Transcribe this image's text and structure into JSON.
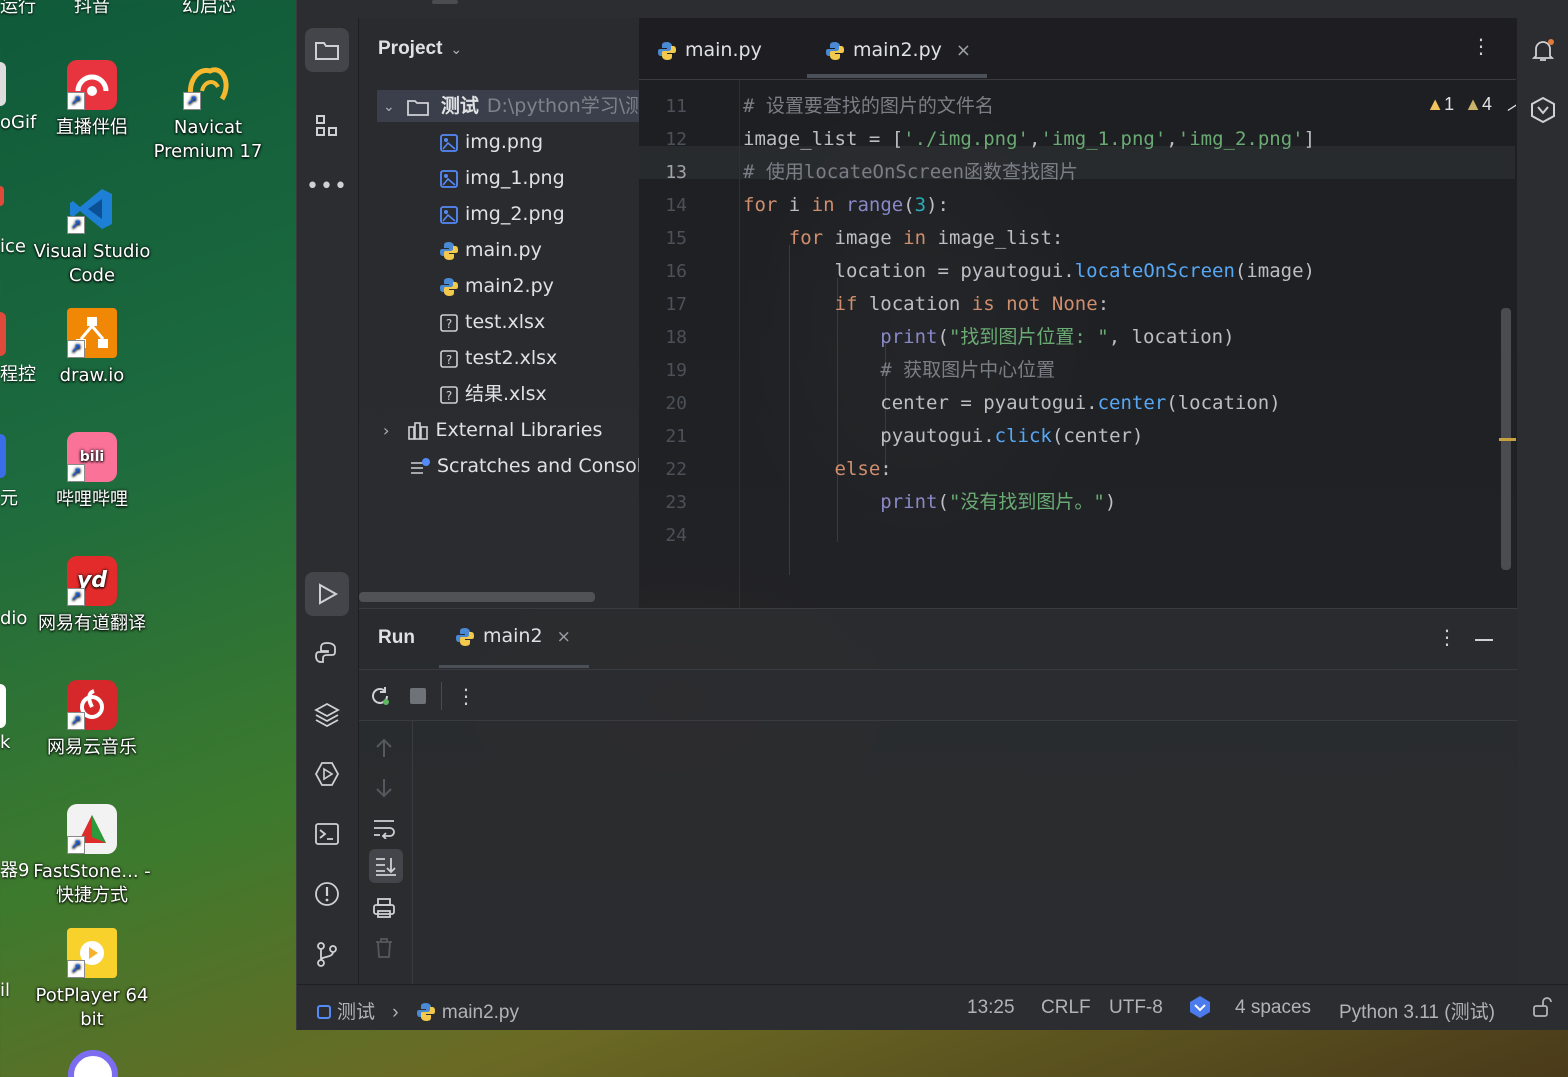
{
  "desktop": {
    "top_labels": [
      "运行",
      "抖音",
      "幻启芯"
    ],
    "icons": [
      {
        "label": "直播伴侣",
        "color": "#e8343f"
      },
      {
        "label": "Navicat Premium 17",
        "color": "#f5b82e"
      },
      {
        "label": "Visual Studio Code",
        "color": "#1e7fd6"
      },
      {
        "label": "draw.io",
        "color": "#f08705"
      },
      {
        "label": "哔哩哔哩",
        "color": "#fb7299"
      },
      {
        "label": "网易有道翻译",
        "color": "#e42b2b"
      },
      {
        "label": "网易云音乐",
        "color": "#d6272b"
      },
      {
        "label": "FastStone... - 快捷方式",
        "color": "#f2f2f2"
      },
      {
        "label": "PotPlayer 64 bit",
        "color": "#f8d12c"
      }
    ],
    "cut_labels": [
      "oGif",
      "ice",
      "程控",
      "元",
      "dio",
      "k",
      "器9",
      "il"
    ]
  },
  "project": {
    "title": "Project",
    "root": {
      "name": "测试",
      "path": "D:\\python学习\\测"
    },
    "files": [
      {
        "name": "img.png",
        "type": "image"
      },
      {
        "name": "img_1.png",
        "type": "image"
      },
      {
        "name": "img_2.png",
        "type": "image"
      },
      {
        "name": "main.py",
        "type": "python"
      },
      {
        "name": "main2.py",
        "type": "python"
      },
      {
        "name": "test.xlsx",
        "type": "unknown"
      },
      {
        "name": "test2.xlsx",
        "type": "unknown"
      },
      {
        "name": "结果.xlsx",
        "type": "unknown"
      }
    ],
    "external": "External Libraries",
    "scratches": "Scratches and Consol"
  },
  "editor": {
    "tabs": [
      {
        "label": "main.py",
        "active": false
      },
      {
        "label": "main2.py",
        "active": true
      }
    ],
    "close_glyph": "×",
    "inspections": {
      "warnings_a": "1",
      "warnings_b": "4"
    },
    "current_line": 13,
    "lines": [
      {
        "n": "11",
        "code": "# 设置要查找的图片的文件名"
      },
      {
        "n": "12",
        "code": "image_list = ['./img.png','img_1.png','img_2.png']"
      },
      {
        "n": "13",
        "code": "# 使用locateOnScreen函数查找图片"
      },
      {
        "n": "14",
        "code": "for i in range(3):"
      },
      {
        "n": "15",
        "code": "    for image in image_list:"
      },
      {
        "n": "16",
        "code": "        location = pyautogui.locateOnScreen(image)"
      },
      {
        "n": "17",
        "code": "        if location is not None:"
      },
      {
        "n": "18",
        "code": "            print(\"找到图片位置: \", location)"
      },
      {
        "n": "19",
        "code": "            # 获取图片中心位置"
      },
      {
        "n": "20",
        "code": "            center = pyautogui.center(location)"
      },
      {
        "n": "21",
        "code": "            pyautogui.click(center)"
      },
      {
        "n": "22",
        "code": "        else:"
      },
      {
        "n": "23",
        "code": "            print(\"没有找到图片。\")"
      },
      {
        "n": "24",
        "code": ""
      }
    ]
  },
  "run": {
    "title": "Run",
    "tab": "main2"
  },
  "status": {
    "breadcrumb_project": "测试",
    "breadcrumb_file": "main2.py",
    "position": "13:25",
    "line_sep": "CRLF",
    "encoding": "UTF-8",
    "indent": "4 spaces",
    "interpreter": "Python 3.11 (测试)"
  },
  "colors": {
    "keyword": "#cf8e6d",
    "function": "#56a8f5",
    "string": "#6aab73",
    "comment": "#7a7e85",
    "number": "#2aacb8",
    "warning": "#f2c55c"
  }
}
